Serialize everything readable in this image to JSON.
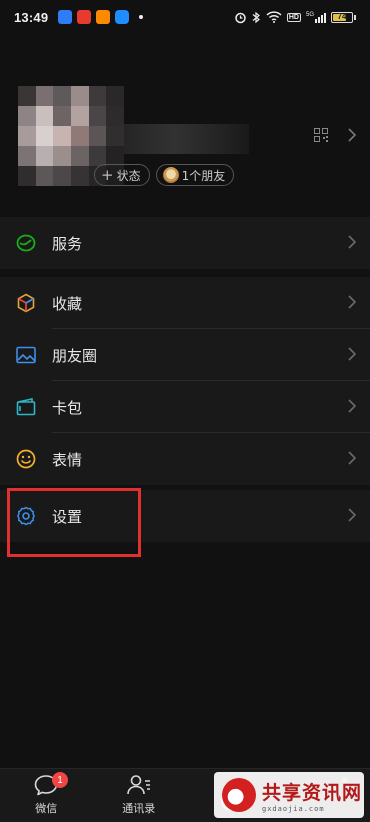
{
  "status_bar": {
    "time": "13:49",
    "app_icon_colors": [
      "#2e7cf6",
      "#e63b2e",
      "#ff8a00",
      "#1f8cff"
    ],
    "battery": "74",
    "network_label": "HD",
    "signal_label": "5G"
  },
  "profile": {
    "status_button": "状态",
    "friends_button": "1个朋友"
  },
  "menu": {
    "services": "服务",
    "favorites": "收藏",
    "moments": "朋友圈",
    "cards": "卡包",
    "stickers": "表情",
    "settings": "设置"
  },
  "tabs": {
    "chats": "微信",
    "chats_badge": "1",
    "contacts": "通讯录"
  },
  "watermark": {
    "cn": "共享资讯网",
    "en": "gxdaojia.com"
  },
  "colors": {
    "accent_green": "#1aad19",
    "highlight_red": "#e03030",
    "badge_red": "#f04545",
    "favorites_icon": "#e8a33c",
    "moments_icon": "#3d8fea",
    "cards_icon": "#2fb5c4",
    "stickers_icon": "#f2b32c",
    "settings_icon": "#3d8fea"
  }
}
